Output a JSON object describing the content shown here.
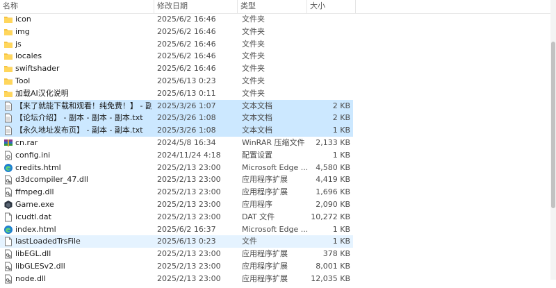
{
  "columns": {
    "name": "名称",
    "date": "修改日期",
    "type": "类型",
    "size": "大小"
  },
  "files": [
    {
      "name": "icon",
      "date": "2025/6/2 16:46",
      "type": "文件夹",
      "size": "",
      "icon": "folder-icon",
      "state": ""
    },
    {
      "name": "img",
      "date": "2025/6/2 16:46",
      "type": "文件夹",
      "size": "",
      "icon": "folder-icon",
      "state": ""
    },
    {
      "name": "js",
      "date": "2025/6/2 16:46",
      "type": "文件夹",
      "size": "",
      "icon": "folder-icon",
      "state": ""
    },
    {
      "name": "locales",
      "date": "2025/6/2 16:46",
      "type": "文件夹",
      "size": "",
      "icon": "folder-icon",
      "state": ""
    },
    {
      "name": "swiftshader",
      "date": "2025/6/2 16:46",
      "type": "文件夹",
      "size": "",
      "icon": "folder-icon",
      "state": ""
    },
    {
      "name": "Tool",
      "date": "2025/6/13 0:23",
      "type": "文件夹",
      "size": "",
      "icon": "folder-icon",
      "state": ""
    },
    {
      "name": "加载AI汉化说明",
      "date": "2025/6/13 0:11",
      "type": "文件夹",
      "size": "",
      "icon": "folder-icon",
      "state": ""
    },
    {
      "name": "【来了就能下载和观看！纯免费！】 - 副...",
      "date": "2025/3/26 1:07",
      "type": "文本文档",
      "size": "2 KB",
      "icon": "text-file-icon",
      "state": "selected"
    },
    {
      "name": "【论坛介绍】 - 副本 - 副本 - 副本.txt",
      "date": "2025/3/26 1:08",
      "type": "文本文档",
      "size": "2 KB",
      "icon": "text-file-icon",
      "state": "selected"
    },
    {
      "name": "【永久地址发布页】 - 副本 - 副本.txt",
      "date": "2025/3/26 1:08",
      "type": "文本文档",
      "size": "1 KB",
      "icon": "text-file-icon",
      "state": "selected"
    },
    {
      "name": "cn.rar",
      "date": "2024/5/8 16:34",
      "type": "WinRAR 压缩文件",
      "size": "2,133 KB",
      "icon": "archive-icon",
      "state": ""
    },
    {
      "name": "config.ini",
      "date": "2024/11/24 4:18",
      "type": "配置设置",
      "size": "1 KB",
      "icon": "settings-file-icon",
      "state": ""
    },
    {
      "name": "credits.html",
      "date": "2025/2/13 23:00",
      "type": "Microsoft Edge ...",
      "size": "4,580 KB",
      "icon": "edge-icon",
      "state": ""
    },
    {
      "name": "d3dcompiler_47.dll",
      "date": "2025/2/13 23:00",
      "type": "应用程序扩展",
      "size": "4,419 KB",
      "icon": "dll-icon",
      "state": ""
    },
    {
      "name": "ffmpeg.dll",
      "date": "2025/2/13 23:00",
      "type": "应用程序扩展",
      "size": "1,696 KB",
      "icon": "dll-icon",
      "state": ""
    },
    {
      "name": "Game.exe",
      "date": "2025/2/13 23:00",
      "type": "应用程序",
      "size": "2,090 KB",
      "icon": "game-exe-icon",
      "state": ""
    },
    {
      "name": "icudtl.dat",
      "date": "2025/2/13 23:00",
      "type": "DAT 文件",
      "size": "10,272 KB",
      "icon": "file-icon",
      "state": ""
    },
    {
      "name": "index.html",
      "date": "2025/6/2 16:37",
      "type": "Microsoft Edge ...",
      "size": "1 KB",
      "icon": "edge-icon",
      "state": ""
    },
    {
      "name": "lastLoadedTrsFile",
      "date": "2025/6/13 0:23",
      "type": "文件",
      "size": "1 KB",
      "icon": "file-icon",
      "state": "hover"
    },
    {
      "name": "libEGL.dll",
      "date": "2025/2/13 23:00",
      "type": "应用程序扩展",
      "size": "378 KB",
      "icon": "dll-icon",
      "state": ""
    },
    {
      "name": "libGLESv2.dll",
      "date": "2025/2/13 23:00",
      "type": "应用程序扩展",
      "size": "8,001 KB",
      "icon": "dll-icon",
      "state": ""
    },
    {
      "name": "node.dll",
      "date": "2025/2/13 23:00",
      "type": "应用程序扩展",
      "size": "12,035 KB",
      "icon": "dll-icon",
      "state": ""
    }
  ],
  "colors": {
    "selected_bg": "#cce8ff",
    "hover_bg": "#e5f3ff",
    "folder": "#f5c343",
    "edge": "#1f7fd0"
  }
}
